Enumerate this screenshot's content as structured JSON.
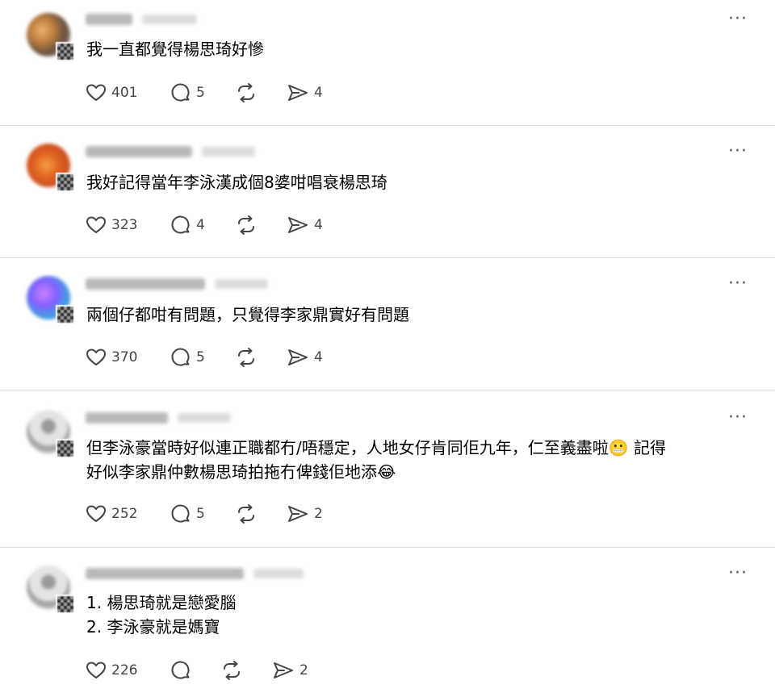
{
  "colors": {
    "divider": "#dddddd",
    "icon": "#444444",
    "text": "#000000"
  },
  "posts": [
    {
      "username": "fiiessi",
      "time": "1-1-2",
      "text": "我一直都覺得楊思琦好慘",
      "likes": "401",
      "replies": "5",
      "shares": "4",
      "avatar": "orange-bokeh-avatar",
      "more_icon": "···"
    },
    {
      "username": "myparrot527",
      "time": "1-1-2",
      "text": "我好記得當年李泳漢成個8婆咁唱衰楊思琦",
      "likes": "323",
      "replies": "4",
      "shares": "4",
      "avatar": "orange-circle-avatar",
      "more_icon": "···"
    },
    {
      "username": "xyndkshosy",
      "time": "1-1-2",
      "text": "兩個仔都咁有問題，只覺得李家鼎實好有問題",
      "likes": "370",
      "replies": "5",
      "shares": "4",
      "avatar": "purple-blue-avatar",
      "more_icon": "···"
    },
    {
      "username": "ssmmssss",
      "time": "1-1-2",
      "text": "但李泳豪當時好似連正職都冇/唔穩定，人地女仔肯同佢九年，仁至義盡啦😬 記得\n好似李家鼎仲數楊思琦拍拖冇俾錢佢地添😂",
      "likes": "252",
      "replies": "5",
      "shares": "2",
      "avatar": "default-gray-avatar",
      "more_icon": "···"
    },
    {
      "username": "hmwtvhsvgeskd",
      "time": "1-1-2",
      "text": "1. 楊思琦就是戀愛腦\n2. 李泳豪就是媽寶",
      "likes": "226",
      "replies": "",
      "shares": "2",
      "avatar": "default-gray-avatar",
      "more_icon": "···"
    }
  ]
}
